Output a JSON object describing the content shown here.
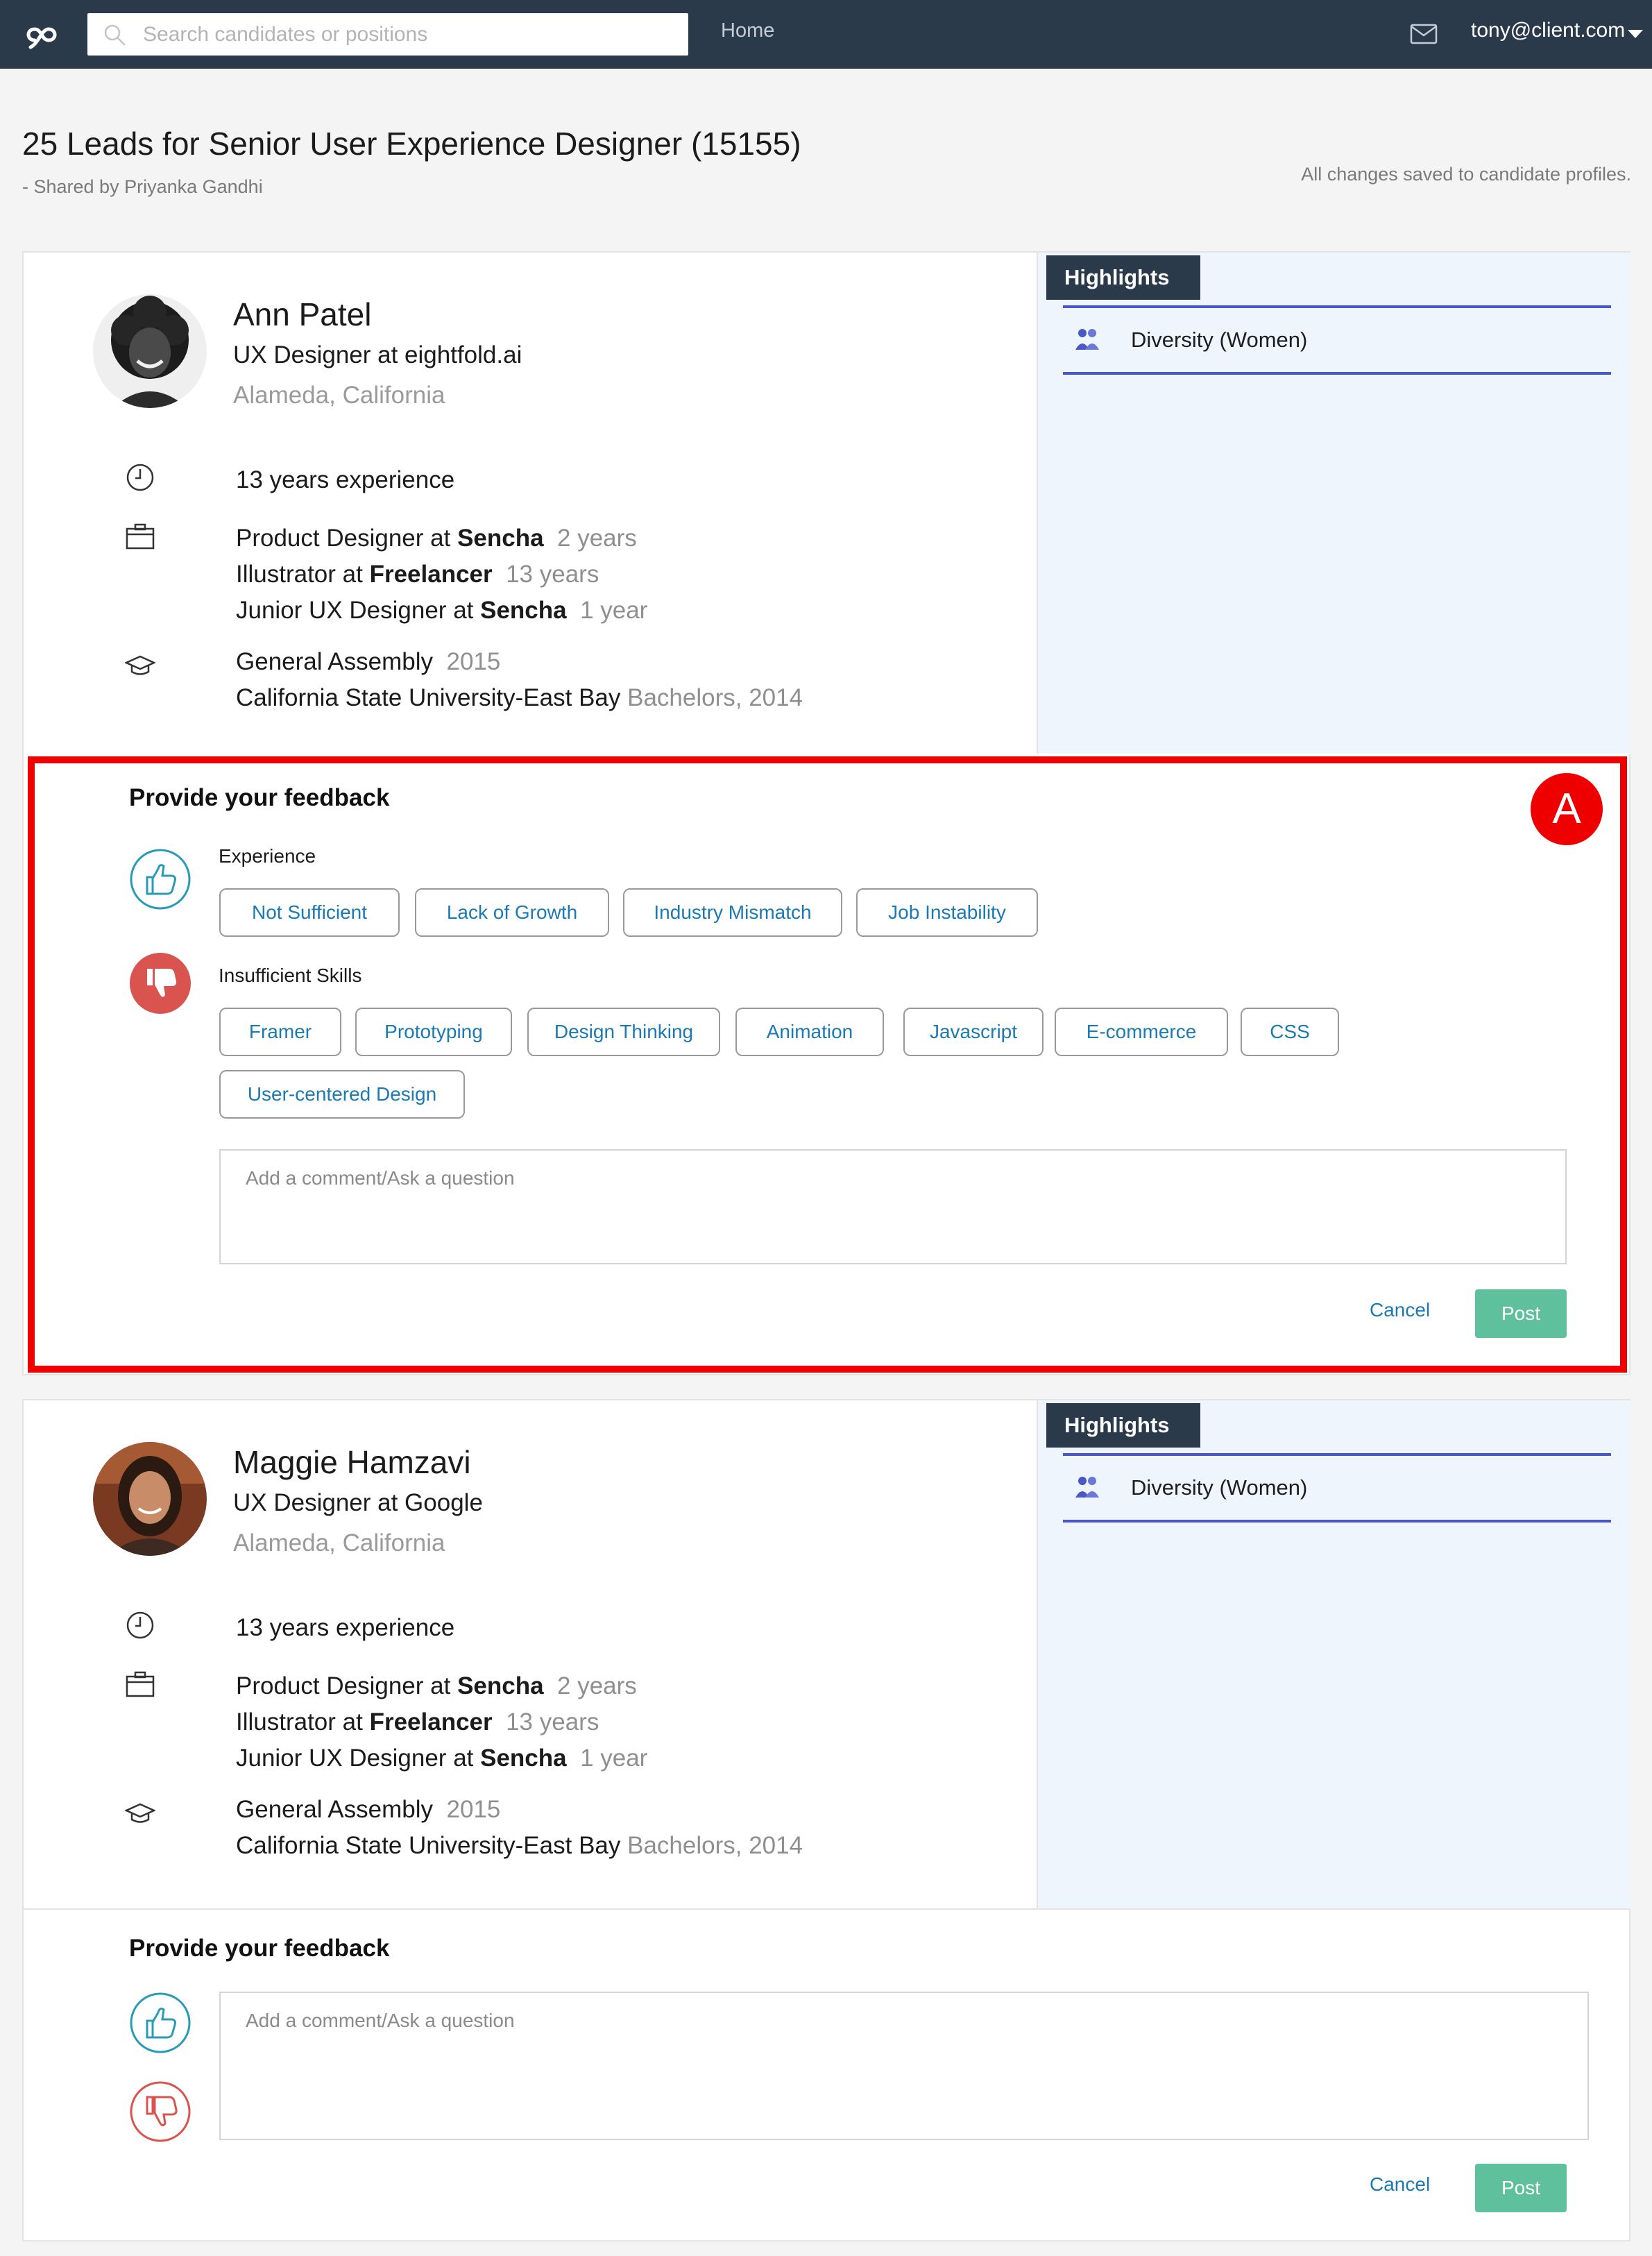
{
  "topbar": {
    "search_placeholder": "Search candidates or positions",
    "nav_home": "Home",
    "user_email": "tony@client.com",
    "brand_color": "#2b3a4a"
  },
  "page": {
    "title": "25 Leads for Senior User Experience Designer (15155)",
    "shared_by": "- Shared by Priyanka Gandhi",
    "saved_note": "All changes saved to candidate profiles."
  },
  "candidates": [
    {
      "name": "Ann Patel",
      "role": "UX Designer at eightfold.ai",
      "location": "Alameda, California",
      "experience_years": "13 years experience",
      "jobs": [
        {
          "title": "Product Designer at ",
          "company": "Sencha",
          "duration": "2 years"
        },
        {
          "title": "Illustrator at ",
          "company": "Freelancer",
          "duration": "13 years"
        },
        {
          "title": "Junior UX Designer at ",
          "company": "Sencha",
          "duration": "1 year"
        }
      ],
      "education": [
        {
          "school": "General Assembly",
          "detail": "2015"
        },
        {
          "school": "California State University-East Bay",
          "detail": "Bachelors,  2014"
        }
      ],
      "highlights_tab": "Highlights",
      "highlights": [
        "Diversity (Women)"
      ],
      "feedback": {
        "title": "Provide your feedback",
        "experience_label": "Experience",
        "experience_chips": [
          "Not Sufficient",
          "Lack of Growth",
          "Industry Mismatch",
          "Job Instability"
        ],
        "skills_label": "Insufficient Skills",
        "skill_chips": [
          "Framer",
          "Prototyping",
          "Design Thinking",
          "Animation",
          "Javascript",
          "E-commerce",
          "CSS",
          "User-centered Design"
        ],
        "comment_placeholder": "Add a comment/Ask a question",
        "cancel_label": "Cancel",
        "post_label": "Post"
      }
    },
    {
      "name": "Maggie Hamzavi",
      "role": "UX Designer at Google",
      "location": "Alameda, California",
      "experience_years": "13 years experience",
      "jobs": [
        {
          "title": "Product Designer at ",
          "company": "Sencha",
          "duration": "2 years"
        },
        {
          "title": "Illustrator at ",
          "company": "Freelancer",
          "duration": "13 years"
        },
        {
          "title": "Junior UX Designer at ",
          "company": "Sencha",
          "duration": "1 year"
        }
      ],
      "education": [
        {
          "school": "General Assembly",
          "detail": "2015"
        },
        {
          "school": "California State University-East Bay",
          "detail": "Bachelors,  2014"
        }
      ],
      "highlights_tab": "Highlights",
      "highlights": [
        "Diversity (Women)"
      ],
      "feedback": {
        "title": "Provide your feedback",
        "comment_placeholder": "Add a comment/Ask a question",
        "cancel_label": "Cancel",
        "post_label": "Post"
      }
    }
  ],
  "annotation": {
    "label": "A",
    "color": "#ee0000"
  },
  "colors": {
    "accent_blue": "#1b79b3",
    "post_green": "#5ec09d",
    "thumb_up": "#2a9bb7",
    "thumb_down": "#d9534f",
    "highlight_line": "#4958c4"
  },
  "icons": [
    "logo-icon",
    "search-icon",
    "mail-icon",
    "clock-icon",
    "briefcase-icon",
    "graduation-cap-icon",
    "diversity-icon",
    "thumbs-up-icon",
    "thumbs-down-icon"
  ]
}
